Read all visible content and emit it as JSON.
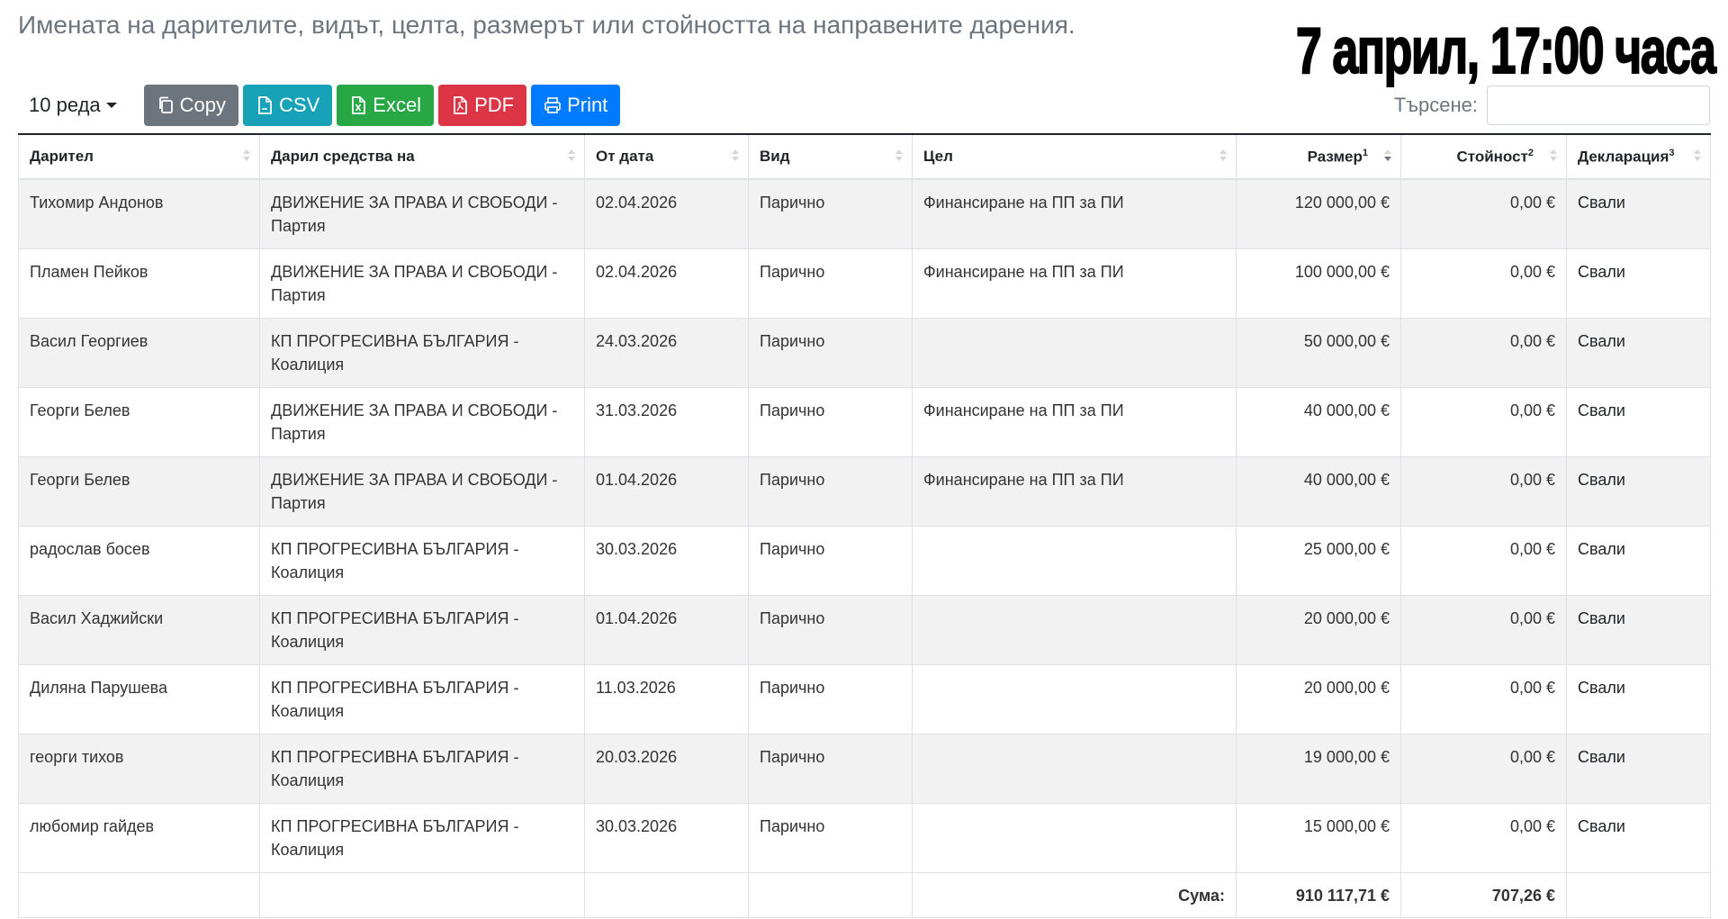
{
  "header": {
    "subtitle": "Имената на дарителите, видът, целта, размерът или стойността на направените дарения.",
    "overlay_title": "7 април, 17:00 часа"
  },
  "toolbar": {
    "length_label": "10 реда",
    "buttons": {
      "copy": "Copy",
      "csv": "CSV",
      "excel": "Excel",
      "pdf": "PDF",
      "print": "Print"
    }
  },
  "search": {
    "label": "Търсене:",
    "value": "",
    "placeholder": ""
  },
  "table": {
    "columns": {
      "donor": "Дарител",
      "recipient": "Дарил средства на",
      "date": "От дата",
      "type": "Вид",
      "purpose": "Цел",
      "amount": "Размер",
      "amount_sup": "1",
      "value": "Стойност",
      "value_sup": "2",
      "declaration": "Декларация",
      "declaration_sup": "3"
    },
    "sorted_column": "amount",
    "sort_direction": "desc",
    "rows": [
      {
        "donor": "Тихомир Андонов",
        "recipient": "ДВИЖЕНИЕ ЗА ПРАВА И СВОБОДИ - Партия",
        "date": "02.04.2026",
        "type": "Парично",
        "purpose": "Финансиране на ПП за ПИ",
        "amount": "120 000,00 €",
        "value": "0,00 €",
        "declaration": "Свали"
      },
      {
        "donor": "Пламен Пейков",
        "recipient": "ДВИЖЕНИЕ ЗА ПРАВА И СВОБОДИ - Партия",
        "date": "02.04.2026",
        "type": "Парично",
        "purpose": "Финансиране на ПП за ПИ",
        "amount": "100 000,00 €",
        "value": "0,00 €",
        "declaration": "Свали"
      },
      {
        "donor": "Васил Георгиев",
        "recipient": "КП ПРОГРЕСИВНА БЪЛГАРИЯ - Коалиция",
        "date": "24.03.2026",
        "type": "Парично",
        "purpose": "",
        "amount": "50 000,00 €",
        "value": "0,00 €",
        "declaration": "Свали"
      },
      {
        "donor": "Георги Белев",
        "recipient": "ДВИЖЕНИЕ ЗА ПРАВА И СВОБОДИ - Партия",
        "date": "31.03.2026",
        "type": "Парично",
        "purpose": "Финансиране на ПП за ПИ",
        "amount": "40 000,00 €",
        "value": "0,00 €",
        "declaration": "Свали"
      },
      {
        "donor": "Георги Белев",
        "recipient": "ДВИЖЕНИЕ ЗА ПРАВА И СВОБОДИ - Партия",
        "date": "01.04.2026",
        "type": "Парично",
        "purpose": "Финансиране на ПП за ПИ",
        "amount": "40 000,00 €",
        "value": "0,00 €",
        "declaration": "Свали"
      },
      {
        "donor": "радослав босев",
        "recipient": "КП ПРОГРЕСИВНА БЪЛГАРИЯ - Коалиция",
        "date": "30.03.2026",
        "type": "Парично",
        "purpose": "",
        "amount": "25 000,00 €",
        "value": "0,00 €",
        "declaration": "Свали"
      },
      {
        "donor": "Васил Хаджийски",
        "recipient": "КП ПРОГРЕСИВНА БЪЛГАРИЯ - Коалиция",
        "date": "01.04.2026",
        "type": "Парично",
        "purpose": "",
        "amount": "20 000,00 €",
        "value": "0,00 €",
        "declaration": "Свали"
      },
      {
        "donor": "Диляна Парушева",
        "recipient": "КП ПРОГРЕСИВНА БЪЛГАРИЯ - Коалиция",
        "date": "11.03.2026",
        "type": "Парично",
        "purpose": "",
        "amount": "20 000,00 €",
        "value": "0,00 €",
        "declaration": "Свали"
      },
      {
        "donor": "георги тихов",
        "recipient": "КП ПРОГРЕСИВНА БЪЛГАРИЯ - Коалиция",
        "date": "20.03.2026",
        "type": "Парично",
        "purpose": "",
        "amount": "19 000,00 €",
        "value": "0,00 €",
        "declaration": "Свали"
      },
      {
        "donor": "любомир гайдев",
        "recipient": "КП ПРОГРЕСИВНА БЪЛГАРИЯ - Коалиция",
        "date": "30.03.2026",
        "type": "Парично",
        "purpose": "",
        "amount": "15 000,00 €",
        "value": "0,00 €",
        "declaration": "Свали"
      }
    ],
    "footer": {
      "sum_label": "Сума:",
      "amount_total": "910 117,71 €",
      "value_total": "707,26 €"
    }
  }
}
